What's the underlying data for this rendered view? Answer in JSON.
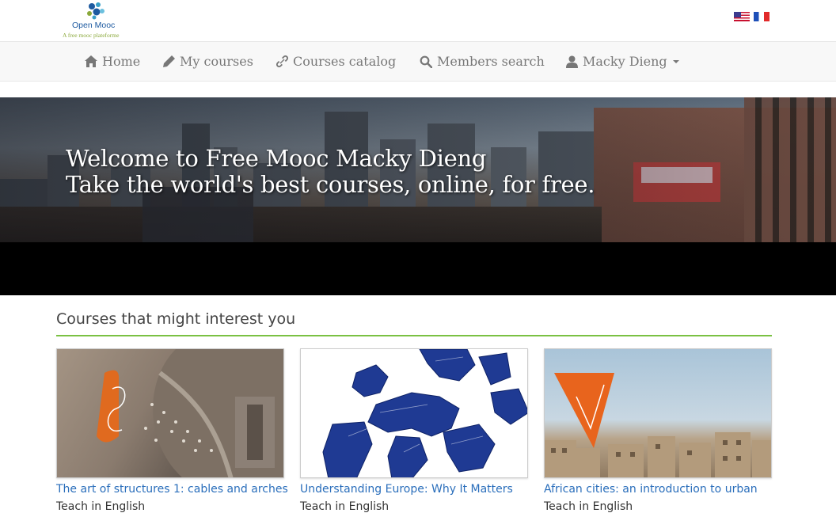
{
  "brand": {
    "name": "Open Mooc",
    "tagline": "A free mooc plateforme"
  },
  "languages": [
    {
      "code": "en",
      "icon": "flag-us-icon"
    },
    {
      "code": "fr",
      "icon": "flag-fr-icon"
    }
  ],
  "nav": {
    "home": "Home",
    "my_courses": "My courses",
    "catalog": "Courses catalog",
    "members": "Members search",
    "user": "Macky Dieng"
  },
  "hero": {
    "line1": "Welcome to Free Mooc Macky Dieng",
    "line2": "Take the world's best courses, online, for free."
  },
  "section": {
    "title": "Courses that might interest you"
  },
  "courses": [
    {
      "title": "The art of structures 1: cables and arches",
      "language": "Teach in English"
    },
    {
      "title": "Understanding Europe: Why It Matters",
      "language": "Teach in English"
    },
    {
      "title": "African cities: an introduction to urban",
      "language": "Teach in English"
    }
  ],
  "colors": {
    "accent_green": "#7ac143",
    "link_blue": "#2a6ebb",
    "nav_text": "#777777"
  }
}
